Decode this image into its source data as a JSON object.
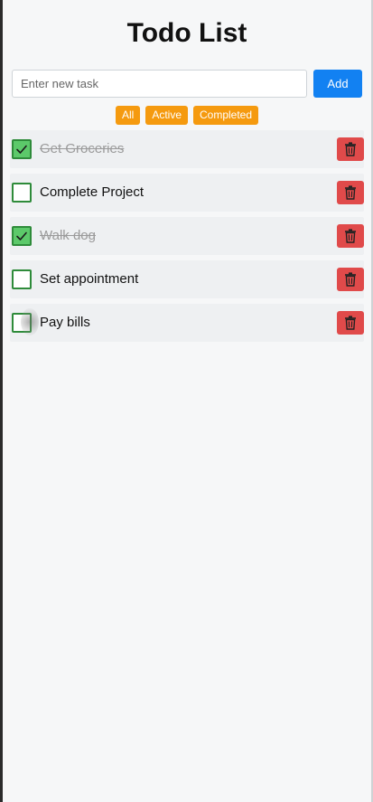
{
  "app": {
    "title": "Todo List"
  },
  "new_task": {
    "placeholder": "Enter new task",
    "value": "",
    "add_label": "Add"
  },
  "filters": [
    {
      "label": "All"
    },
    {
      "label": "Active"
    },
    {
      "label": "Completed"
    }
  ],
  "todos": [
    {
      "text": "Get Groceries",
      "completed": true
    },
    {
      "text": "Complete Project",
      "completed": false
    },
    {
      "text": "Walk dog",
      "completed": true
    },
    {
      "text": "Set appointment",
      "completed": false
    },
    {
      "text": "Pay bills",
      "completed": false
    }
  ],
  "colors": {
    "accent": "#1281f2",
    "filter": "#f59a0f",
    "delete": "#e04a4a",
    "check": "#5cc96a",
    "check_border": "#2e8b3a"
  },
  "icons": {
    "check": "checkmark-icon",
    "delete": "trash-icon"
  }
}
